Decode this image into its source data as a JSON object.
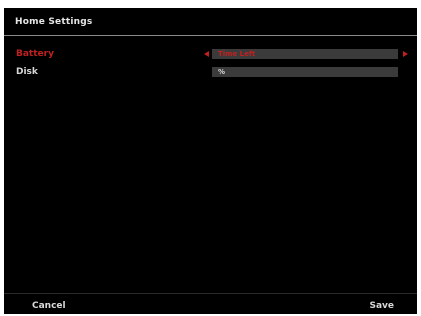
{
  "header": {
    "title": "Home Settings"
  },
  "settings": [
    {
      "label": "Battery",
      "value": "Time Left",
      "selected": true
    },
    {
      "label": "Disk",
      "value": "%",
      "selected": false
    }
  ],
  "footer": {
    "cancel_label": "Cancel",
    "save_label": "Save"
  },
  "colors": {
    "background": "#000000",
    "text": "#d8d8d8",
    "selected": "#c0201f",
    "value_box": "#3b3b3b",
    "rule": "#8a8a8a"
  },
  "icons": {
    "left_arrow": "left-arrow-icon",
    "right_arrow": "right-arrow-icon"
  }
}
